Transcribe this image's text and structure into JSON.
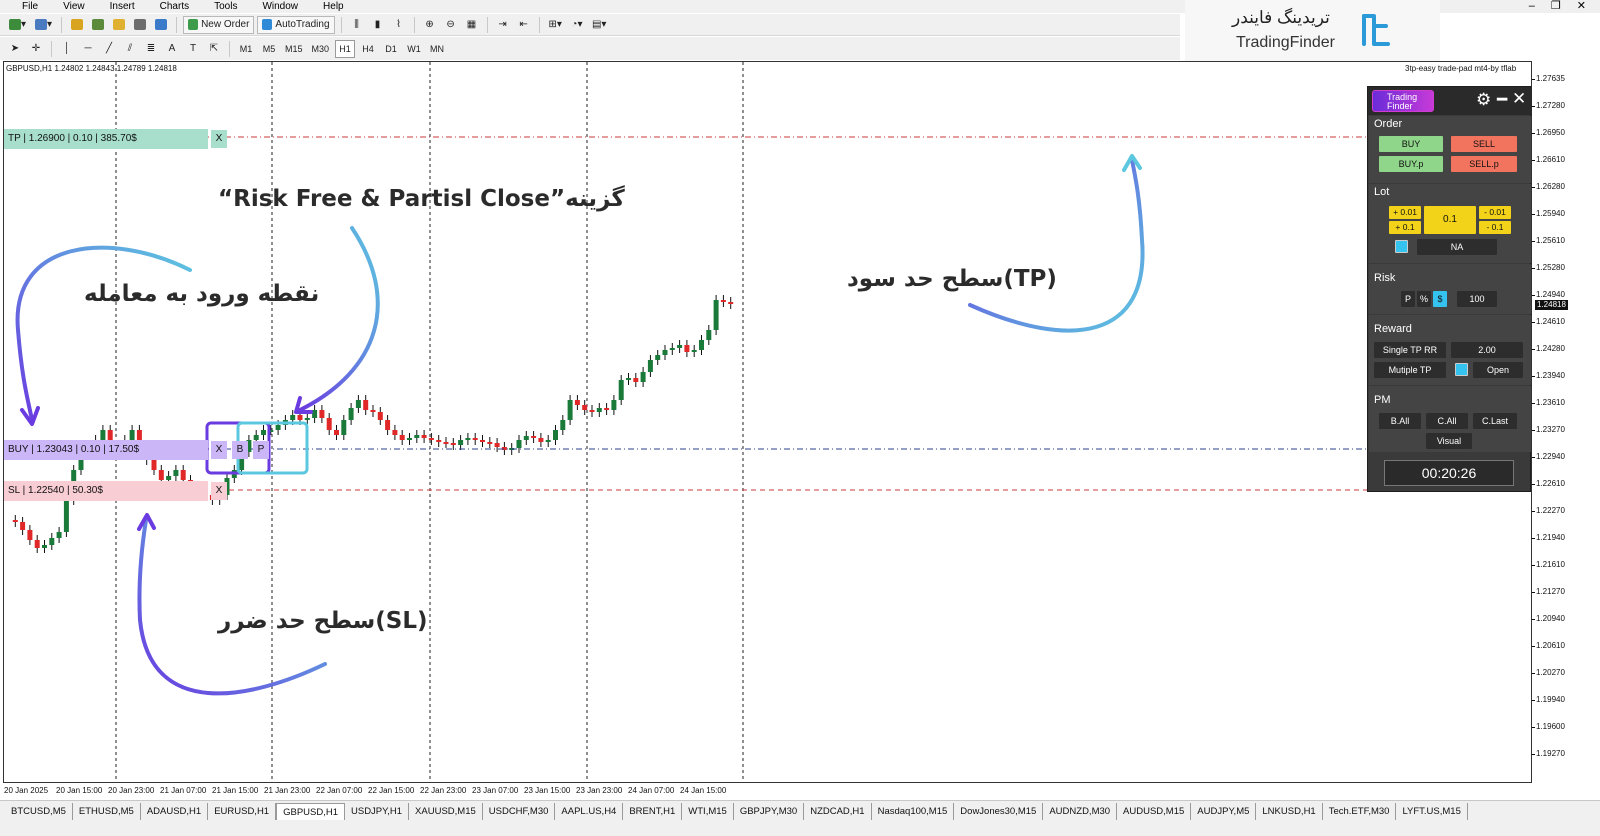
{
  "menu": [
    "File",
    "View",
    "Insert",
    "Charts",
    "Tools",
    "Window",
    "Help"
  ],
  "toolbar": {
    "new_order": "New Order",
    "auto_trading": "AutoTrading",
    "timeframes": [
      "M1",
      "M5",
      "M15",
      "M30",
      "H1",
      "H4",
      "D1",
      "W1",
      "MN"
    ],
    "selected_timeframe": "H1"
  },
  "brand": {
    "fa": "تریدینگ فایندر",
    "en": "TradingFinder"
  },
  "chart": {
    "title": "GBPUSD,H1  1.24802 1.24843 1.24789 1.24818",
    "ea_label": "3tp-easy trade-pad mt4-by tflab",
    "current_price": "1.24818",
    "price_labels": [
      "1.27635",
      "1.27280",
      "1.26950",
      "1.26610",
      "1.26280",
      "1.25940",
      "1.25610",
      "1.25280",
      "1.24940",
      "1.24610",
      "1.24280",
      "1.23940",
      "1.23610",
      "1.23270",
      "1.22940",
      "1.22610",
      "1.22270",
      "1.21940",
      "1.21610",
      "1.21270",
      "1.20940",
      "1.20610",
      "1.20270",
      "1.19940",
      "1.19600",
      "1.19270"
    ],
    "time_labels": [
      "20 Jan 2025",
      "20 Jan 15:00",
      "20 Jan 23:00",
      "21 Jan 07:00",
      "21 Jan 15:00",
      "21 Jan 23:00",
      "22 Jan 07:00",
      "22 Jan 15:00",
      "22 Jan 23:00",
      "23 Jan 07:00",
      "23 Jan 15:00",
      "23 Jan 23:00",
      "24 Jan 07:00",
      "24 Jan 15:00"
    ]
  },
  "trade": {
    "tp": "TP | 1.26900 | 0.10 | 385.70$",
    "buy": "BUY | 1.23043 | 0.10 | 17.50$",
    "sl": "SL | 1.22540 | 50.30$",
    "x": "X",
    "b": "B",
    "p": "P"
  },
  "annotations": {
    "risk_free": "“Risk Free & Partisl Close”گزینه",
    "entry": "نقطه ورود به معامله",
    "tp_level": "سطح حد سود(TP)",
    "sl_level": "سطح حد ضرر(SL)"
  },
  "panel": {
    "brand_line1": "Trading",
    "brand_line2": "Finder",
    "order_title": "Order",
    "buy": "BUY",
    "sell": "SELL",
    "buy_p": "BUY.p",
    "sell_p": "SELL.p",
    "lot_title": "Lot",
    "plus_001": "+ 0.01",
    "plus_01": "+ 0.1",
    "lot_value": "0.1",
    "minus_001": "- 0.01",
    "minus_01": "- 0.1",
    "na": "NA",
    "risk_title": "Risk",
    "risk_p": "P",
    "risk_pct": "%",
    "risk_usd": "$",
    "risk_value": "100",
    "reward_title": "Reward",
    "single_tp": "Single TP RR",
    "rr_value": "2.00",
    "multiple_tp": "Mutiple TP",
    "open": "Open",
    "pm_title": "PM",
    "b_all": "B.All",
    "c_all": "C.All",
    "c_last": "C.Last",
    "visual": "Visual",
    "timer": "00:20:26"
  },
  "tabs": [
    "BTCUSD,M5",
    "ETHUSD,M5",
    "ADAUSD,H1",
    "EURUSD,H1",
    "GBPUSD,H1",
    "USDJPY,H1",
    "XAUUSD,M15",
    "USDCHF,M30",
    "AAPL.US,H4",
    "BRENT,H1",
    "WTI,M15",
    "GBPJPY,M30",
    "NZDCAD,H1",
    "Nasdaq100,M15",
    "DowJones30,M15",
    "AUDNZD,M30",
    "AUDUSD,M15",
    "AUDJPY,M5",
    "LNKUSD,H1",
    "Tech.ETF,M30",
    "LYFT.US,M15"
  ],
  "active_tab": "GBPUSD,H1",
  "colors": {
    "bull": "#1a7a3a",
    "bear": "#e02828",
    "tp_line": "#c8383a",
    "entry_line": "#2c3f8c",
    "arrow_purple": "#6a3be0",
    "arrow_cyan": "#5cc8e0"
  }
}
